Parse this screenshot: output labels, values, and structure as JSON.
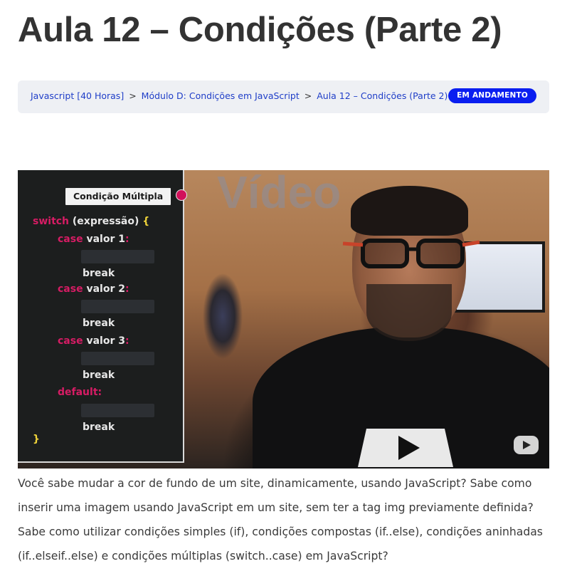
{
  "page": {
    "title": "Aula 12 – Condições (Parte 2)"
  },
  "breadcrumb": {
    "items": [
      "Javascript [40 Horas]",
      "Módulo D: Condições em JavaScript",
      "Aula 12 – Condições (Parte 2)"
    ],
    "separator": ">",
    "status_badge": "EM ANDAMENTO"
  },
  "video": {
    "wall_text": "Vídeo",
    "panel_label": "Condição Múltipla",
    "code": {
      "line1_kw": "switch",
      "line1_text": " (expressão) ",
      "line1_brace": "{",
      "case_kw": "case",
      "case1_text": " valor 1",
      "case2_text": " valor 2",
      "case3_text": " valor 3",
      "colon": ":",
      "break_text": "break",
      "default_kw": "default",
      "close_brace": "}"
    }
  },
  "description": "Você sabe mudar a cor de fundo de um site, dinamicamente, usando JavaScript? Sabe como inserir uma imagem usando JavaScript em um site, sem ter a tag img previamente definida? Sabe como utilizar condições simples (if), condições compostas (if..else), condições aninhadas (if..elseif..else) e condições múltiplas (switch..case) em JavaScript?",
  "colors": {
    "badge": "#0a1ef0",
    "link": "#1f3ec8",
    "code_keyword": "#d61c64",
    "code_brace": "#f0d43a"
  }
}
